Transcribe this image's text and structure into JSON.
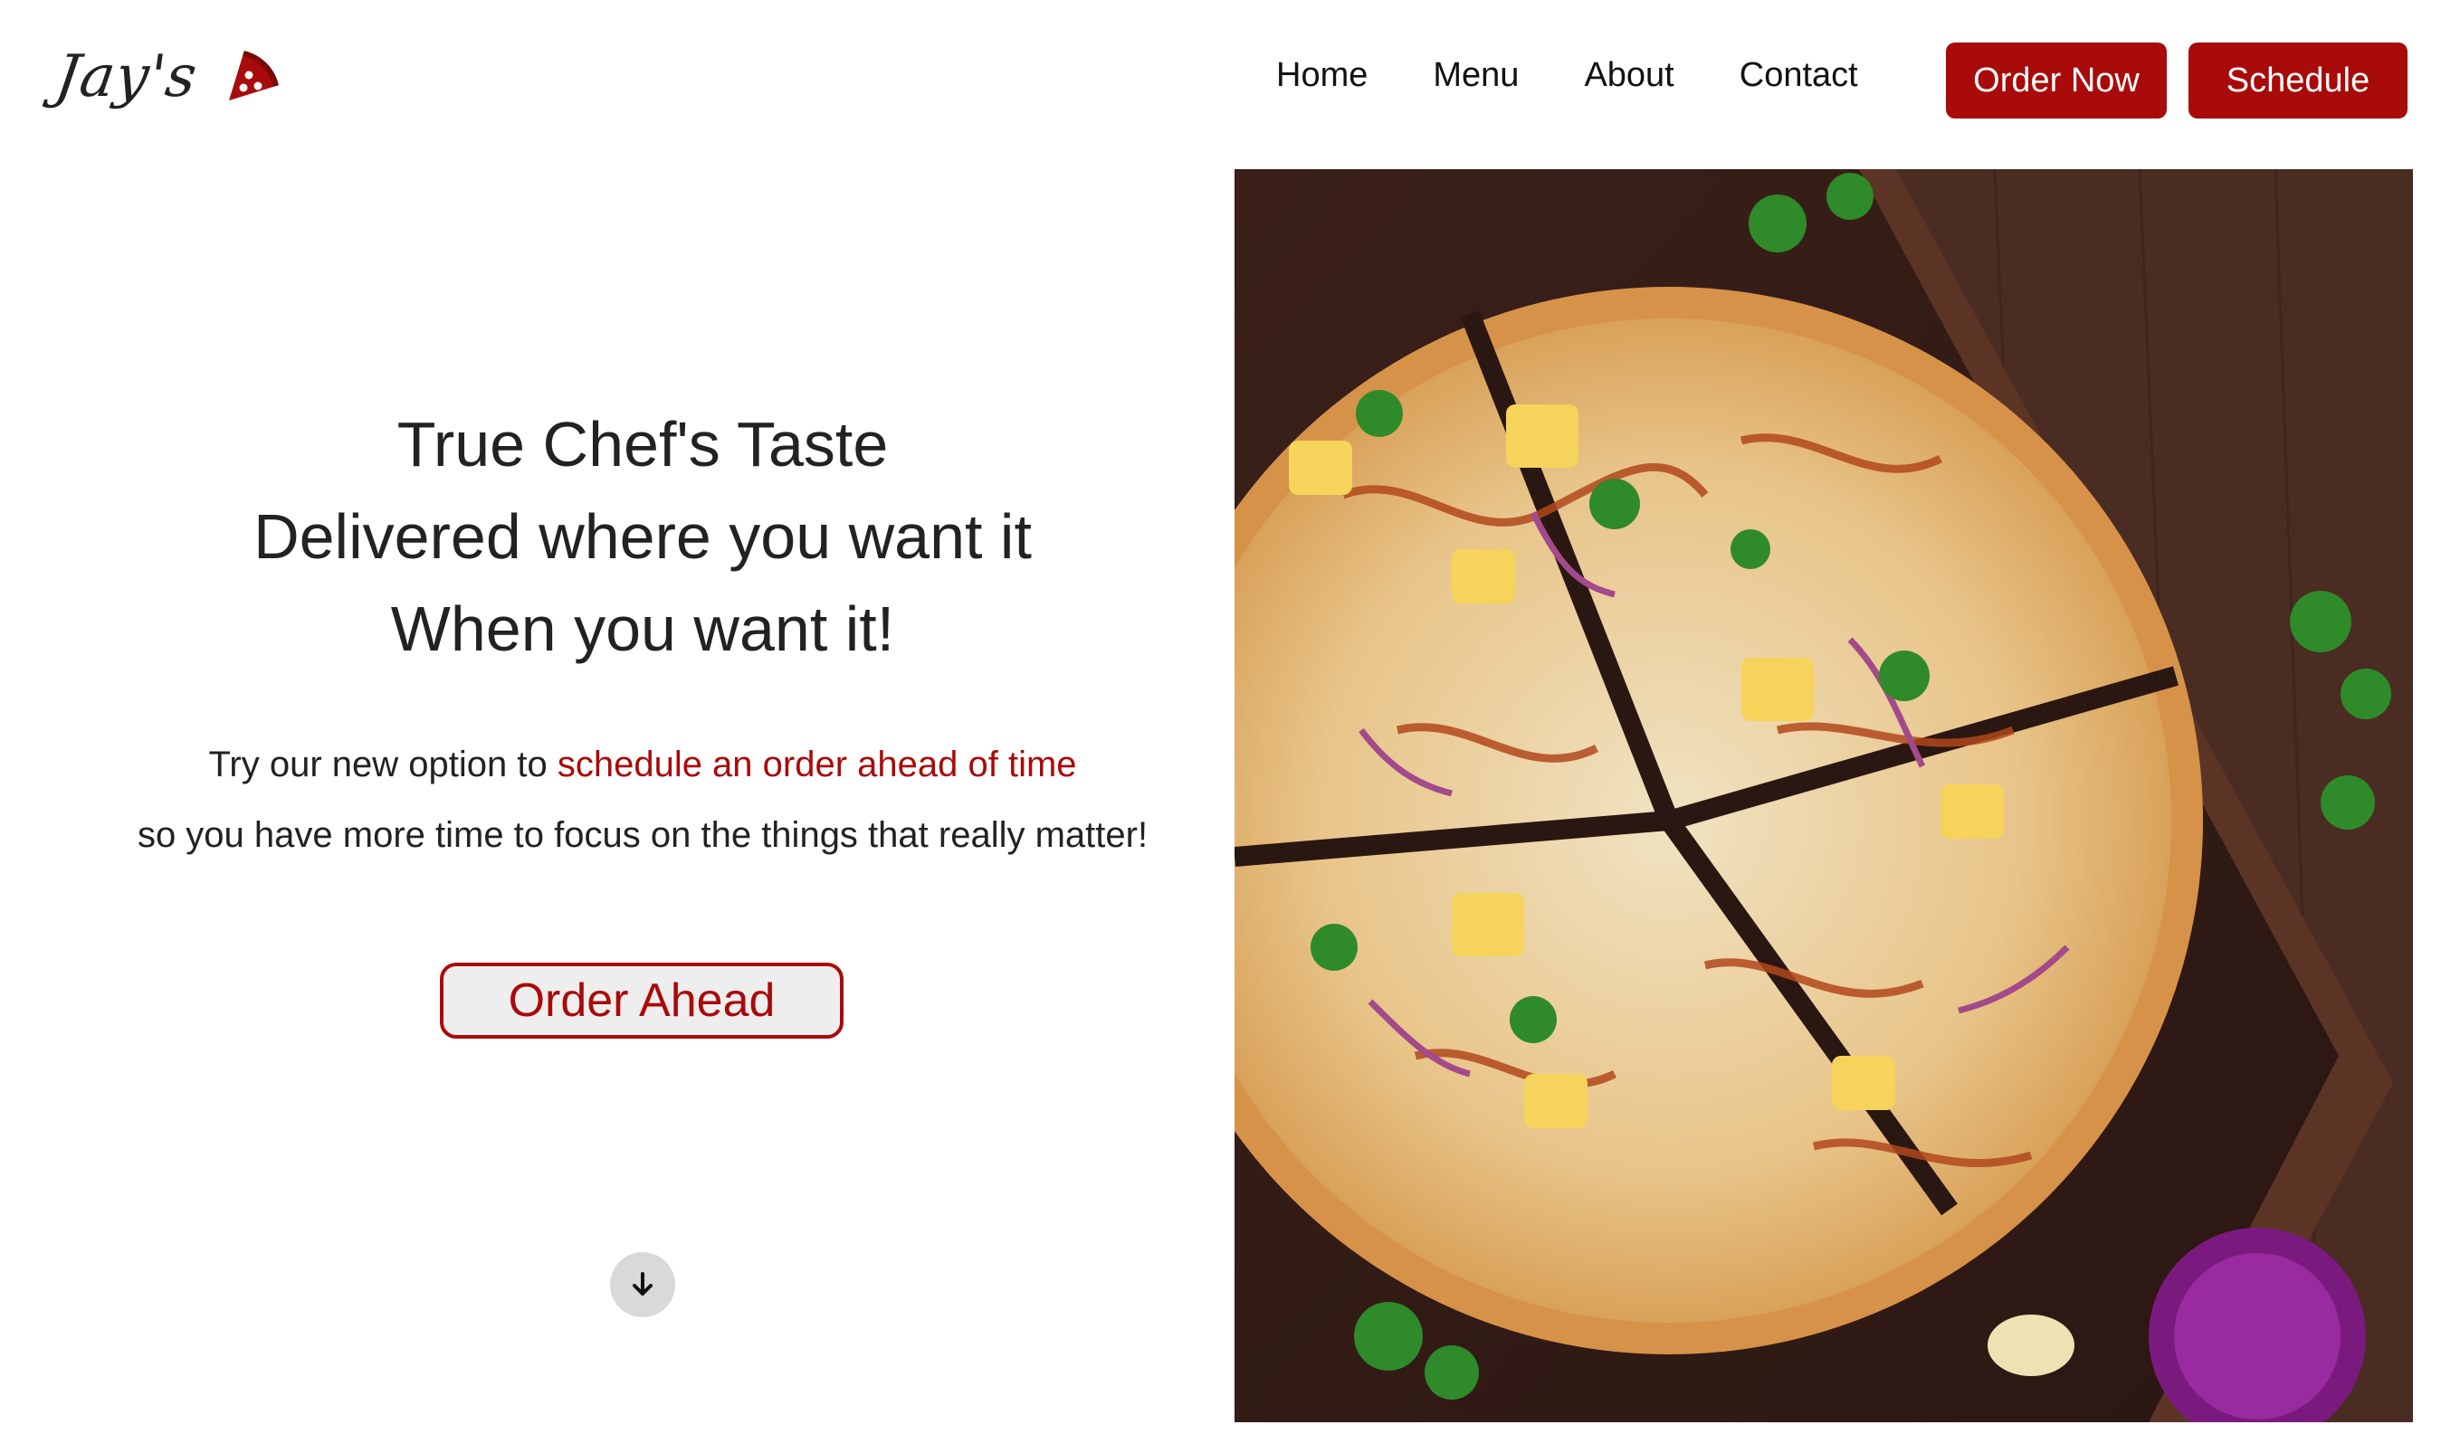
{
  "brand": {
    "name": "Jay's",
    "logo_icon": "pizza-slice-icon"
  },
  "nav": {
    "items": [
      "Home",
      "Menu",
      "About",
      "Contact"
    ]
  },
  "header_buttons": {
    "order_now": "Order Now",
    "schedule": "Schedule"
  },
  "hero": {
    "headline_lines": [
      "True Chef's Taste",
      "Delivered where you want it",
      "When you want it!"
    ],
    "tagline_prefix": "Try our new option to ",
    "tagline_highlight": "schedule an order ahead of time",
    "tagline_suffix": "so you have more time to focus on the things that really matter!",
    "cta": "Order Ahead",
    "scroll_icon": "arrow-down-icon",
    "image_subject": "pizza-photo"
  },
  "colors": {
    "accent": "#a90a0a",
    "text": "#222222",
    "button_bg": "#eeeeee",
    "wood": "#4a2a1f"
  }
}
